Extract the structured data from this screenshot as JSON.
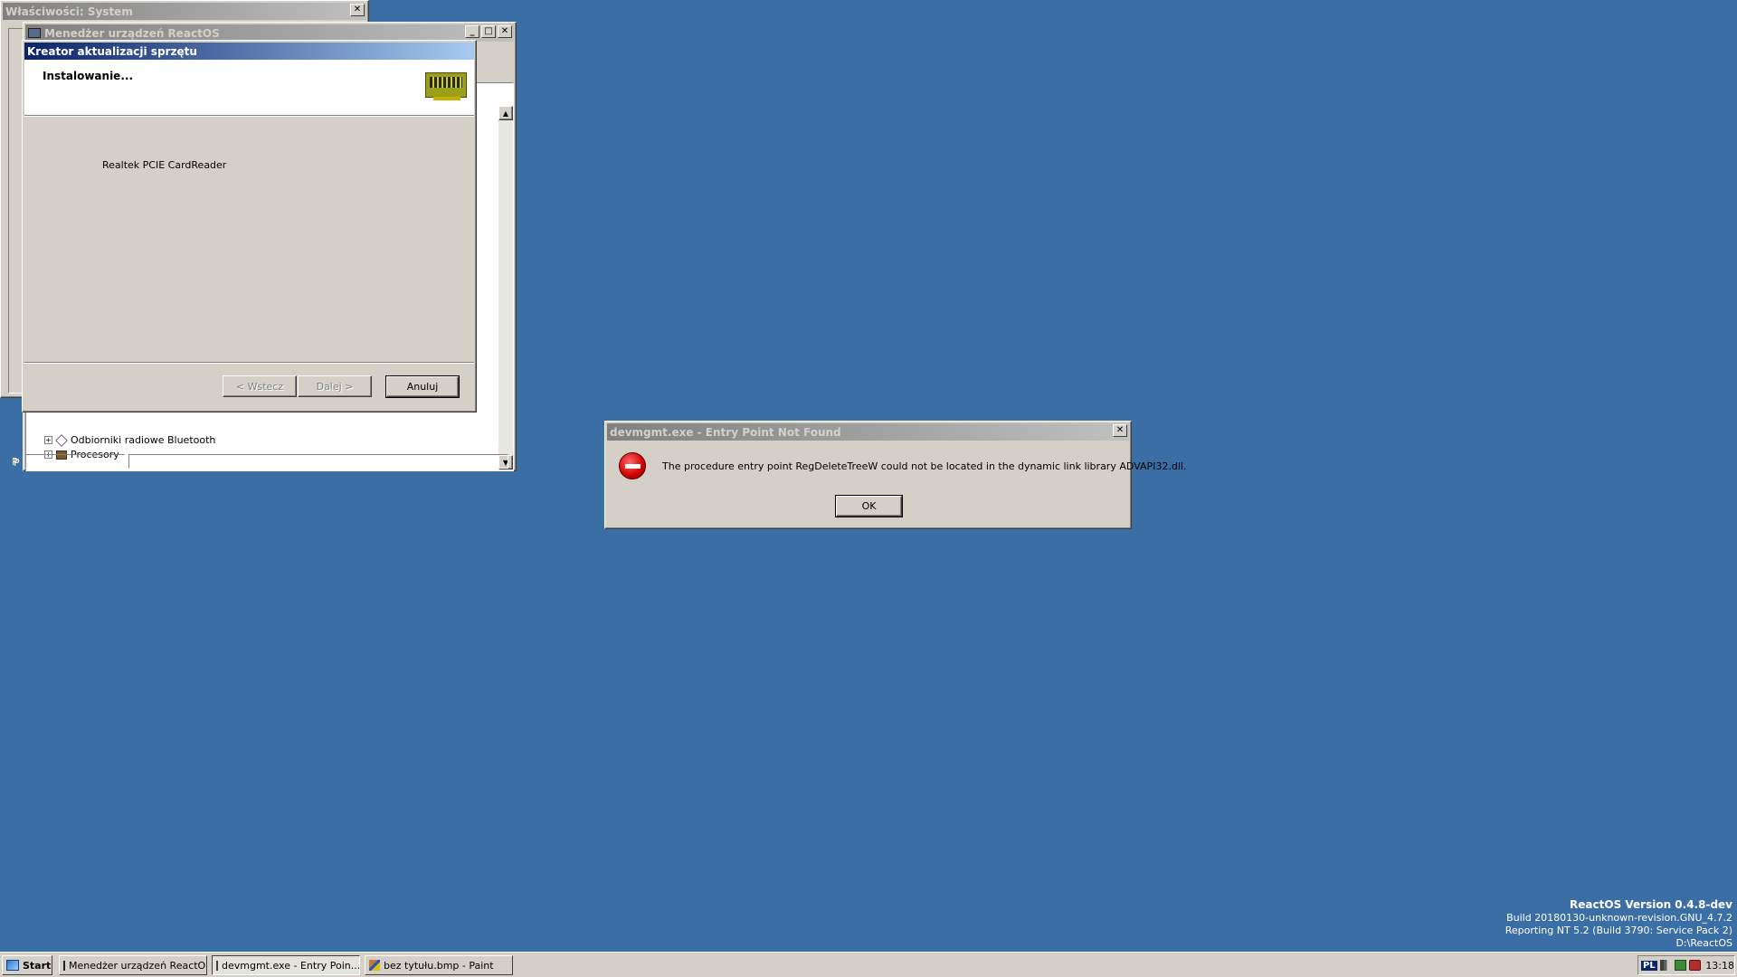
{
  "system_props": {
    "title": "Właściwości: System",
    "close": "✕"
  },
  "devmgr": {
    "title": "Menedżer urządzeń ReactOS",
    "min": "_",
    "max": "□",
    "close": "✕",
    "tree": [
      {
        "expander": "+",
        "label": "Odbiorniki radiowe Bluetooth"
      },
      {
        "expander": "+",
        "label": "Procesory"
      }
    ],
    "scroll_up": "▲",
    "scroll_down": "▼"
  },
  "wizard": {
    "title": "Kreator aktualizacji sprzętu",
    "header": "Instalowanie...",
    "device": "Realtek PCIE CardReader",
    "back": "< Wstecz",
    "next": "Dalej >",
    "cancel": "Anuluj"
  },
  "error_dialog": {
    "title": "devmgmt.exe - Entry Point Not Found",
    "close": "✕",
    "message": "The procedure entry point RegDeleteTreeW could not be located in the dynamic link library ADVAPI32.dll.",
    "ok": "OK"
  },
  "desktop_version": {
    "line1": "ReactOS Version 0.4.8-dev",
    "line2": "Build 20180130-unknown-revision.GNU_4.7.2",
    "line3": "Reporting NT 5.2 (Build 3790: Service Pack 2)",
    "line4": "D:\\ReactOS"
  },
  "taskbar": {
    "start": "Start",
    "tasks": [
      "Menedżer urządzeń ReactOS",
      "devmgmt.exe - Entry Poin...",
      "bez tytułu.bmp - Paint"
    ],
    "lang": "PL",
    "clock": "13:18"
  },
  "stray": {
    "label_p": "P"
  }
}
